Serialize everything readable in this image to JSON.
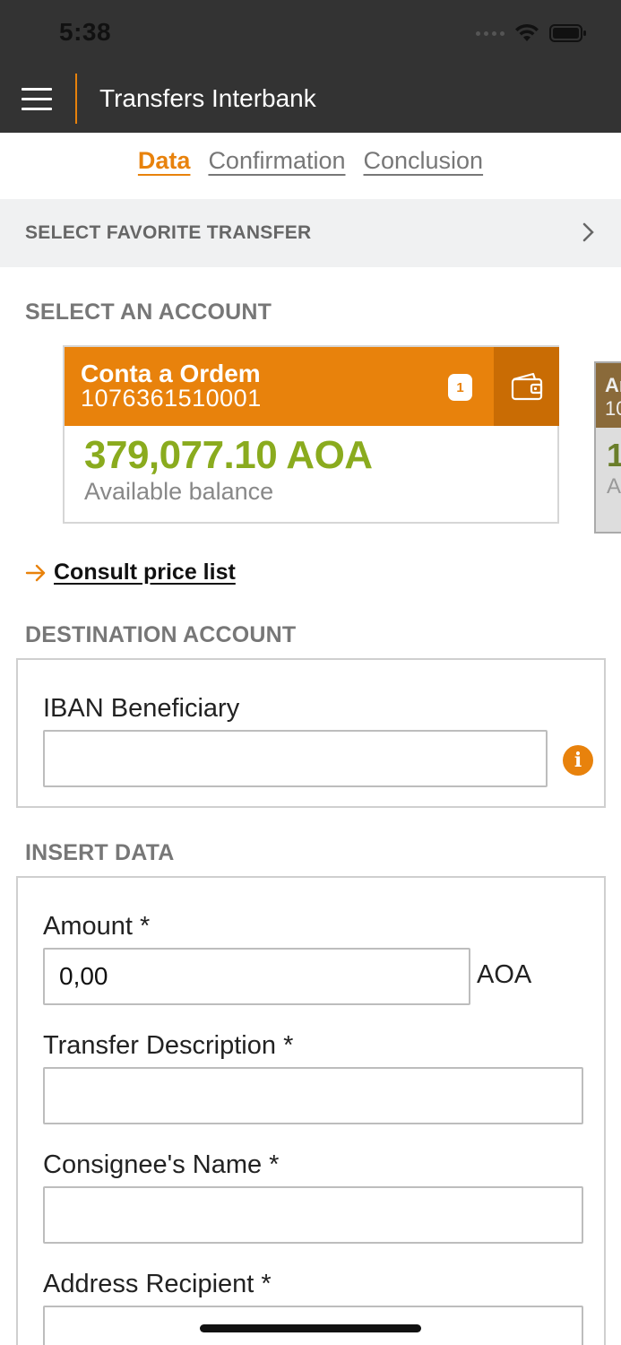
{
  "status_bar": {
    "time": "5:38"
  },
  "header": {
    "title": "Transfers Interbank"
  },
  "steps": [
    {
      "label": "Data",
      "active": true
    },
    {
      "label": "Confirmation",
      "active": false
    },
    {
      "label": "Conclusion",
      "active": false
    }
  ],
  "favorite": {
    "label": "SELECT FAVORITE TRANSFER"
  },
  "account_section": {
    "title": "SELECT AN ACCOUNT"
  },
  "account_card": {
    "name": "Conta a Ordem",
    "number": "1076361510001",
    "badge": "1",
    "balance": "379,077.10  AOA",
    "balance_label": "Available balance"
  },
  "peek_card": {
    "name_fragment": "Ar",
    "number_fragment": "10",
    "balance_fragment": "1",
    "label_fragment": "A"
  },
  "price_list": {
    "label": "Consult price list"
  },
  "destination": {
    "title": "DESTINATION ACCOUNT",
    "iban_label": "IBAN Beneficiary",
    "iban_value": ""
  },
  "insert_data": {
    "title": "INSERT DATA",
    "amount_label": "Amount *",
    "amount_value": "0,00",
    "currency": "AOA",
    "description_label": "Transfer Description *",
    "consignee_label": "Consignee's Name *",
    "address_label": "Address Recipient *"
  },
  "colors": {
    "accent": "#e8820c",
    "header_bg": "#333333",
    "balance_green": "#8aab1e"
  },
  "icons": [
    "hamburger-menu-icon",
    "wifi-icon",
    "battery-icon",
    "chevron-right-icon",
    "wallet-icon",
    "arrow-right-icon",
    "info-icon"
  ]
}
